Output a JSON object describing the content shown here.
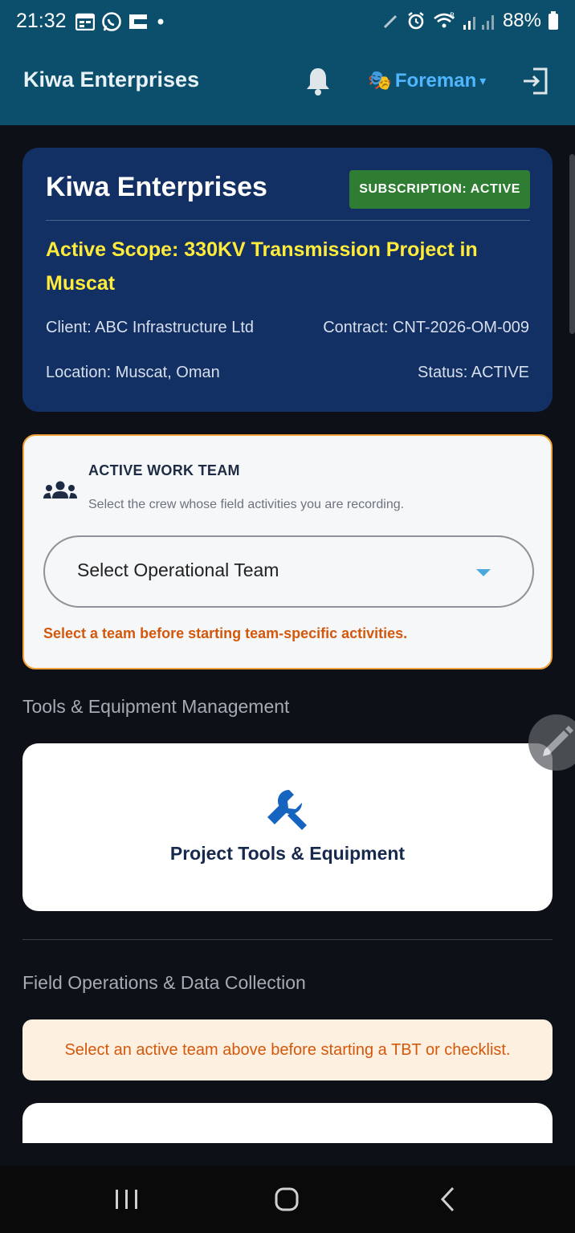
{
  "status_bar": {
    "time": "21:32",
    "battery": "88%",
    "icons": [
      "calendar-icon",
      "whatsapp-icon",
      "app-icon",
      "dot-icon",
      "pen-icon",
      "alarm-icon",
      "wifi-icon",
      "signal-icon",
      "battery-icon"
    ]
  },
  "app_bar": {
    "title": "Kiwa Enterprises",
    "role_label": "Foreman",
    "role_caret": "▾",
    "role_emoji": "🎭"
  },
  "company_card": {
    "name": "Kiwa Enterprises",
    "subscription_badge": "SUBSCRIPTION: ACTIVE",
    "active_scope": "Active Scope: 330KV Transmission Project in Muscat",
    "client": "Client: ABC Infrastructure Ltd",
    "contract": "Contract: CNT-2026-OM-009",
    "location": "Location: Muscat, Oman",
    "status": "Status: ACTIVE"
  },
  "team_card": {
    "title": "ACTIVE WORK TEAM",
    "subtitle": "Select the crew whose field activities you are recording.",
    "select_label": "Select Operational Team",
    "warning": "Select a team before starting team-specific activities."
  },
  "tools_section": {
    "title": "Tools & Equipment Management",
    "card_label": "Project Tools & Equipment"
  },
  "field_section": {
    "title": "Field Operations & Data Collection",
    "notice": "Select an active team above before starting a TBT or checklist."
  },
  "colors": {
    "app_bar": "#0b4f6c",
    "company_card": "#123063",
    "scope_yellow": "#ffeb3b",
    "badge_green": "#2e7d32",
    "team_border": "#f2a33a",
    "warning_orange": "#d4580c",
    "accent_blue": "#1565c0"
  }
}
